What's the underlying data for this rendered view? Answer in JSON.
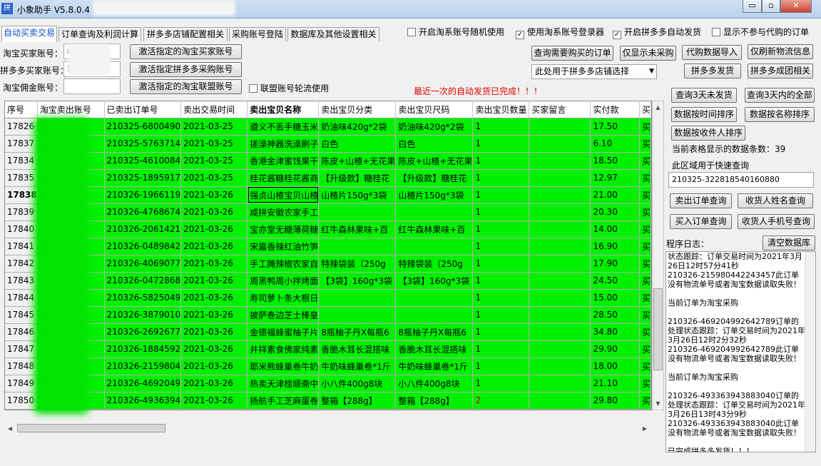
{
  "window": {
    "title": "小象助手 V5.8.0.4",
    "app_icon_glyph": "拼",
    "minimize": "▭",
    "maximize": "▫",
    "close": "✕"
  },
  "tabs": [
    "自动买卖交易",
    "订单查询及利润计算",
    "拼多多店铺配置相关",
    "采购账号登陆",
    "数据库及其他设置相关"
  ],
  "top_checkboxes": [
    {
      "label": "开启淘系账号随机使用",
      "checked": false
    },
    {
      "label": "使用淘系账号登录器",
      "checked": true
    },
    {
      "label": "开启拼多多自动发货",
      "checked": true
    },
    {
      "label": "显示不参与代购的订单",
      "checked": false
    }
  ],
  "accounts": {
    "taobao_buyer_label": "淘宝买家账号：",
    "taobao_buyer_value": "a",
    "pdd_buyer_label": "拼多多买家账号：",
    "pdd_buyer_value": "184***",
    "taobao_alliance_label": "淘宝佣金账号：",
    "taobao_alliance_value": ""
  },
  "account_buttons": [
    "激活指定的淘宝买家账号",
    "激活指定拼多多采购账号",
    "激活指定的淘宝联盟账号"
  ],
  "alliance_rotate": {
    "label": "联盟账号轮流使用",
    "checked": false
  },
  "status_message": "最近一次的自动发货已完成！！！",
  "middle_buttons": {
    "query_need_buy": "查询需要购买的订单",
    "show_unpurchased": "仅显示未采购",
    "agent_import": "代购数据导入",
    "refresh_logistics": "仅刷新物流信息",
    "pdd_ship": "拼多多发货",
    "pdd_group": "拼多多成团相关"
  },
  "shop_select": "此处用于拼多多店铺选择",
  "right_panel": {
    "btn_3day_unshipped": "查询3天未发货",
    "btn_3day_all": "查询3天内的全部",
    "btn_sort_time": "数据按时间排序",
    "btn_sort_name": "数据按名称排序",
    "btn_sort_receiver": "数据按收件人排序",
    "row_count": "当前表格显示的数据条数：39",
    "quick_query_label": "此区域用于快速查询",
    "quick_query_value": "210325-322818540160880",
    "btn_sell_order": "卖出订单查询",
    "btn_receiver_name": "收货人姓名查询",
    "btn_buy_order": "买入订单查询",
    "btn_receiver_phone": "收货人手机号查询",
    "log_label": "程序日志：",
    "btn_clear_db": "清空数据库"
  },
  "log_text": "状态跟踪：订单交易时间为2021年3月26日12时57分41秒\n210326-215980442243457此订单没有物流单号或者淘宝数据读取失败！\n\n当前订单为淘宝采购\n\n210326-469204992642789订单的处理状态跟踪：订单交易时间为2021年3月26日12时2分32秒\n210326-469204992642789此订单没有物流单号或者淘宝数据读取失败！\n\n当前订单为淘宝采购\n\n210326-493363943883040订单的处理状态跟踪：订单交易时间为2021年3月26日13时43分9秒\n210326-493363943883040此订单没有物流单号或者淘宝数据读取失败！\n\n已完成拼多多发货！！！",
  "table": {
    "columns": [
      "序号",
      "淘宝卖出账号",
      "已卖出订单号",
      "卖出交易时间",
      "卖出宝贝名称",
      "卖出宝贝分类",
      "卖出宝贝尺码",
      "卖出宝贝数量",
      "买家留言",
      "实付款",
      "买"
    ],
    "rows": [
      {
        "seq": "17826",
        "account": "店",
        "order": "210325-6800490",
        "time": "2021-03-25",
        "name": "遵义不丢手糖玉米",
        "cat": "奶油味420g*2袋",
        "size": "奶油味420g*2袋",
        "qty": "1",
        "msg": "",
        "paid": "17.50",
        "x": "买"
      },
      {
        "seq": "17837",
        "account": "品店",
        "order": "210325-5763714",
        "time": "2021-03-25",
        "name": "搓澡神器洗澡刷子",
        "cat": "白色",
        "size": "白色",
        "qty": "1",
        "msg": "",
        "paid": "6.10",
        "x": "买"
      },
      {
        "seq": "17834",
        "account": "健专营",
        "order": "210325-4610084",
        "time": "2021-03-25",
        "name": "香港金津蜜饯果干",
        "cat": "陈皮+山楂+无花果",
        "size": "陈皮+山楂+无花果",
        "qty": "1",
        "msg": "",
        "paid": "18.50",
        "x": "买"
      },
      {
        "seq": "17835",
        "account": "健专营",
        "order": "210325-1895917",
        "time": "2021-03-25",
        "name": "桂花酱糖桂花酱商",
        "cat": "【升级款】糖桂花",
        "size": "【升级款】糖桂花",
        "qty": "1",
        "msg": "",
        "paid": "12.97",
        "x": "买"
      },
      {
        "seq": "17838",
        "account": "营店",
        "order": "210326-1966119",
        "time": "2021-03-26",
        "name": "强贞山楂宝贝山楂",
        "cat": "山楂片150g*3袋",
        "size": "山楂片150g*3袋",
        "qty": "1",
        "msg": "",
        "paid": "21.00",
        "x": "买",
        "selected": true
      },
      {
        "seq": "17839",
        "account": "",
        "order": "210326-4768674",
        "time": "2021-03-26",
        "name": "咸拼安徽农家手工",
        "cat": "",
        "size": "",
        "qty": "1",
        "msg": "",
        "paid": "20.30",
        "x": "买"
      },
      {
        "seq": "17840",
        "account": "专营",
        "order": "210326-2061421",
        "time": "2021-03-26",
        "name": "宝亦堂无糖薄荷糖",
        "cat": "红牛森林果味+百",
        "size": "红牛森林果味+百",
        "qty": "1",
        "msg": "",
        "paid": "14.00",
        "x": "买"
      },
      {
        "seq": "17841",
        "account": "店",
        "order": "210326-0489842",
        "time": "2021-03-26",
        "name": "宋嘉香辣红油竹笋",
        "cat": "",
        "size": "",
        "qty": "1",
        "msg": "",
        "paid": "16.90",
        "x": "买"
      },
      {
        "seq": "17842",
        "account": "",
        "order": "210326-4069077",
        "time": "2021-03-26",
        "name": "手工腌辣椒农家自",
        "cat": "特辣袋装（250g",
        "size": "特辣袋装（250g",
        "qty": "1",
        "msg": "",
        "paid": "17.90",
        "x": "买"
      },
      {
        "seq": "17843",
        "account": "",
        "order": "210326-0472868",
        "time": "2021-03-26",
        "name": "周黑鸭周小拌烤面",
        "cat": "【3袋】160g*3袋",
        "size": "【3袋】160g*3袋",
        "qty": "1",
        "msg": "",
        "paid": "24.50",
        "x": "买"
      },
      {
        "seq": "17844",
        "account": "",
        "order": "210326-5825049",
        "time": "2021-03-26",
        "name": "寿司萝卜条大根日",
        "cat": "",
        "size": "",
        "qty": "1",
        "msg": "",
        "paid": "15.00",
        "x": "买"
      },
      {
        "seq": "17845",
        "account": "店",
        "order": "210326-3879010",
        "time": "2021-03-26",
        "name": "披萨卷边芝士棒皇",
        "cat": "",
        "size": "",
        "qty": "1",
        "msg": "",
        "paid": "28.50",
        "x": "买"
      },
      {
        "seq": "17846",
        "account": "营店",
        "order": "210326-2692677",
        "time": "2021-03-26",
        "name": "金德福蜂蜜柚子片",
        "cat": "8瓶柚子丹X每瓶6",
        "size": "8瓶柚子丹X每瓶6",
        "qty": "1",
        "msg": "",
        "paid": "34.80",
        "x": "买"
      },
      {
        "seq": "17847",
        "account": "营店",
        "order": "210326-1884592",
        "time": "2021-03-26",
        "name": "井祥素食佛家纯素",
        "cat": "香脆木耳长混搭味",
        "size": "香脆木耳长混搭味",
        "qty": "1",
        "msg": "",
        "paid": "29.90",
        "x": "买"
      },
      {
        "seq": "17848",
        "account": "营店",
        "order": "210326-2159804",
        "time": "2021-03-26",
        "name": "耶米熊蜂巢卷牛奶",
        "cat": "牛奶味蜂巢卷*1斤",
        "size": "牛奶味蜂巢卷*1斤",
        "qty": "1",
        "msg": "",
        "paid": "18.00",
        "x": "买"
      },
      {
        "seq": "17849",
        "account": "健专营",
        "order": "210326-4692049",
        "time": "2021-03-26",
        "name": "热卖天津桂顺斋中",
        "cat": "小八件400g8块",
        "size": "小八件400g8块",
        "qty": "1",
        "msg": "",
        "paid": "21.10",
        "x": "买"
      },
      {
        "seq": "17850",
        "account": "营店",
        "order": "210326-4936394",
        "time": "2021-03-26",
        "name": "扬航手工芝麻蛋卷",
        "cat": "整箱【288g】",
        "size": "整箱【288g】",
        "qty": "2",
        "msg": "",
        "paid": "29.80",
        "x": "买",
        "qty_red": true
      }
    ]
  }
}
